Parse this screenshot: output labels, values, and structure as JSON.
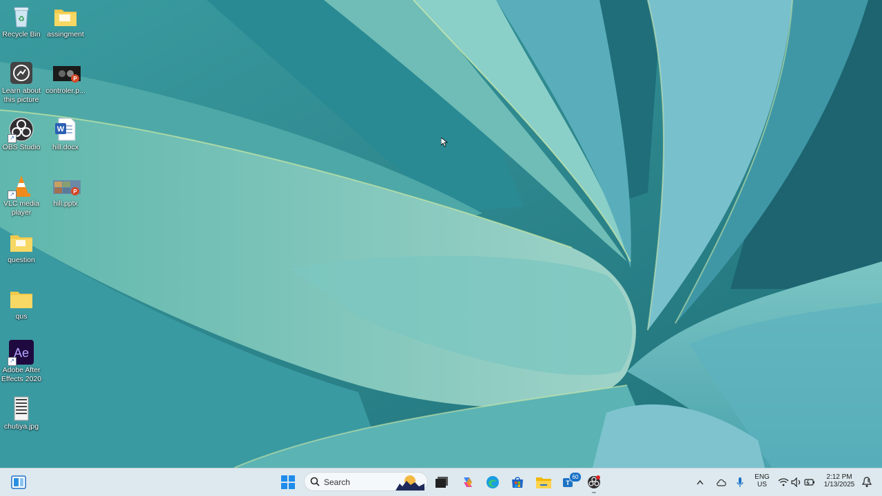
{
  "desktop": {
    "icons": [
      {
        "label": "Recycle Bin"
      },
      {
        "label": "assingment"
      },
      {
        "label": "Learn about this picture"
      },
      {
        "label": "controler.p..."
      },
      {
        "label": "OBS Studio"
      },
      {
        "label": "hill.docx"
      },
      {
        "label": "VLC media player"
      },
      {
        "label": "hill.pptx"
      },
      {
        "label": "question"
      },
      {
        "label": "qus"
      },
      {
        "label": "Adobe After Effects 2020"
      },
      {
        "label": "chutiya.jpg"
      }
    ]
  },
  "taskbar": {
    "widgets_icon": "widgets-icon",
    "start_icon": "windows-start-icon",
    "search_placeholder": "Search",
    "apps": [
      {
        "name": "task-view-icon"
      },
      {
        "name": "copilot-icon"
      },
      {
        "name": "edge-icon"
      },
      {
        "name": "store-icon"
      },
      {
        "name": "file-explorer-icon"
      },
      {
        "name": "teams-icon",
        "badge": "60"
      },
      {
        "name": "obs-icon"
      }
    ],
    "tray": {
      "language_line1": "ENG",
      "language_line2": "US",
      "time": "2:12 PM",
      "date": "1/13/2025"
    }
  },
  "colors": {
    "taskbar_bg": "#dde9ee",
    "accent_blue": "#1a73c8"
  }
}
